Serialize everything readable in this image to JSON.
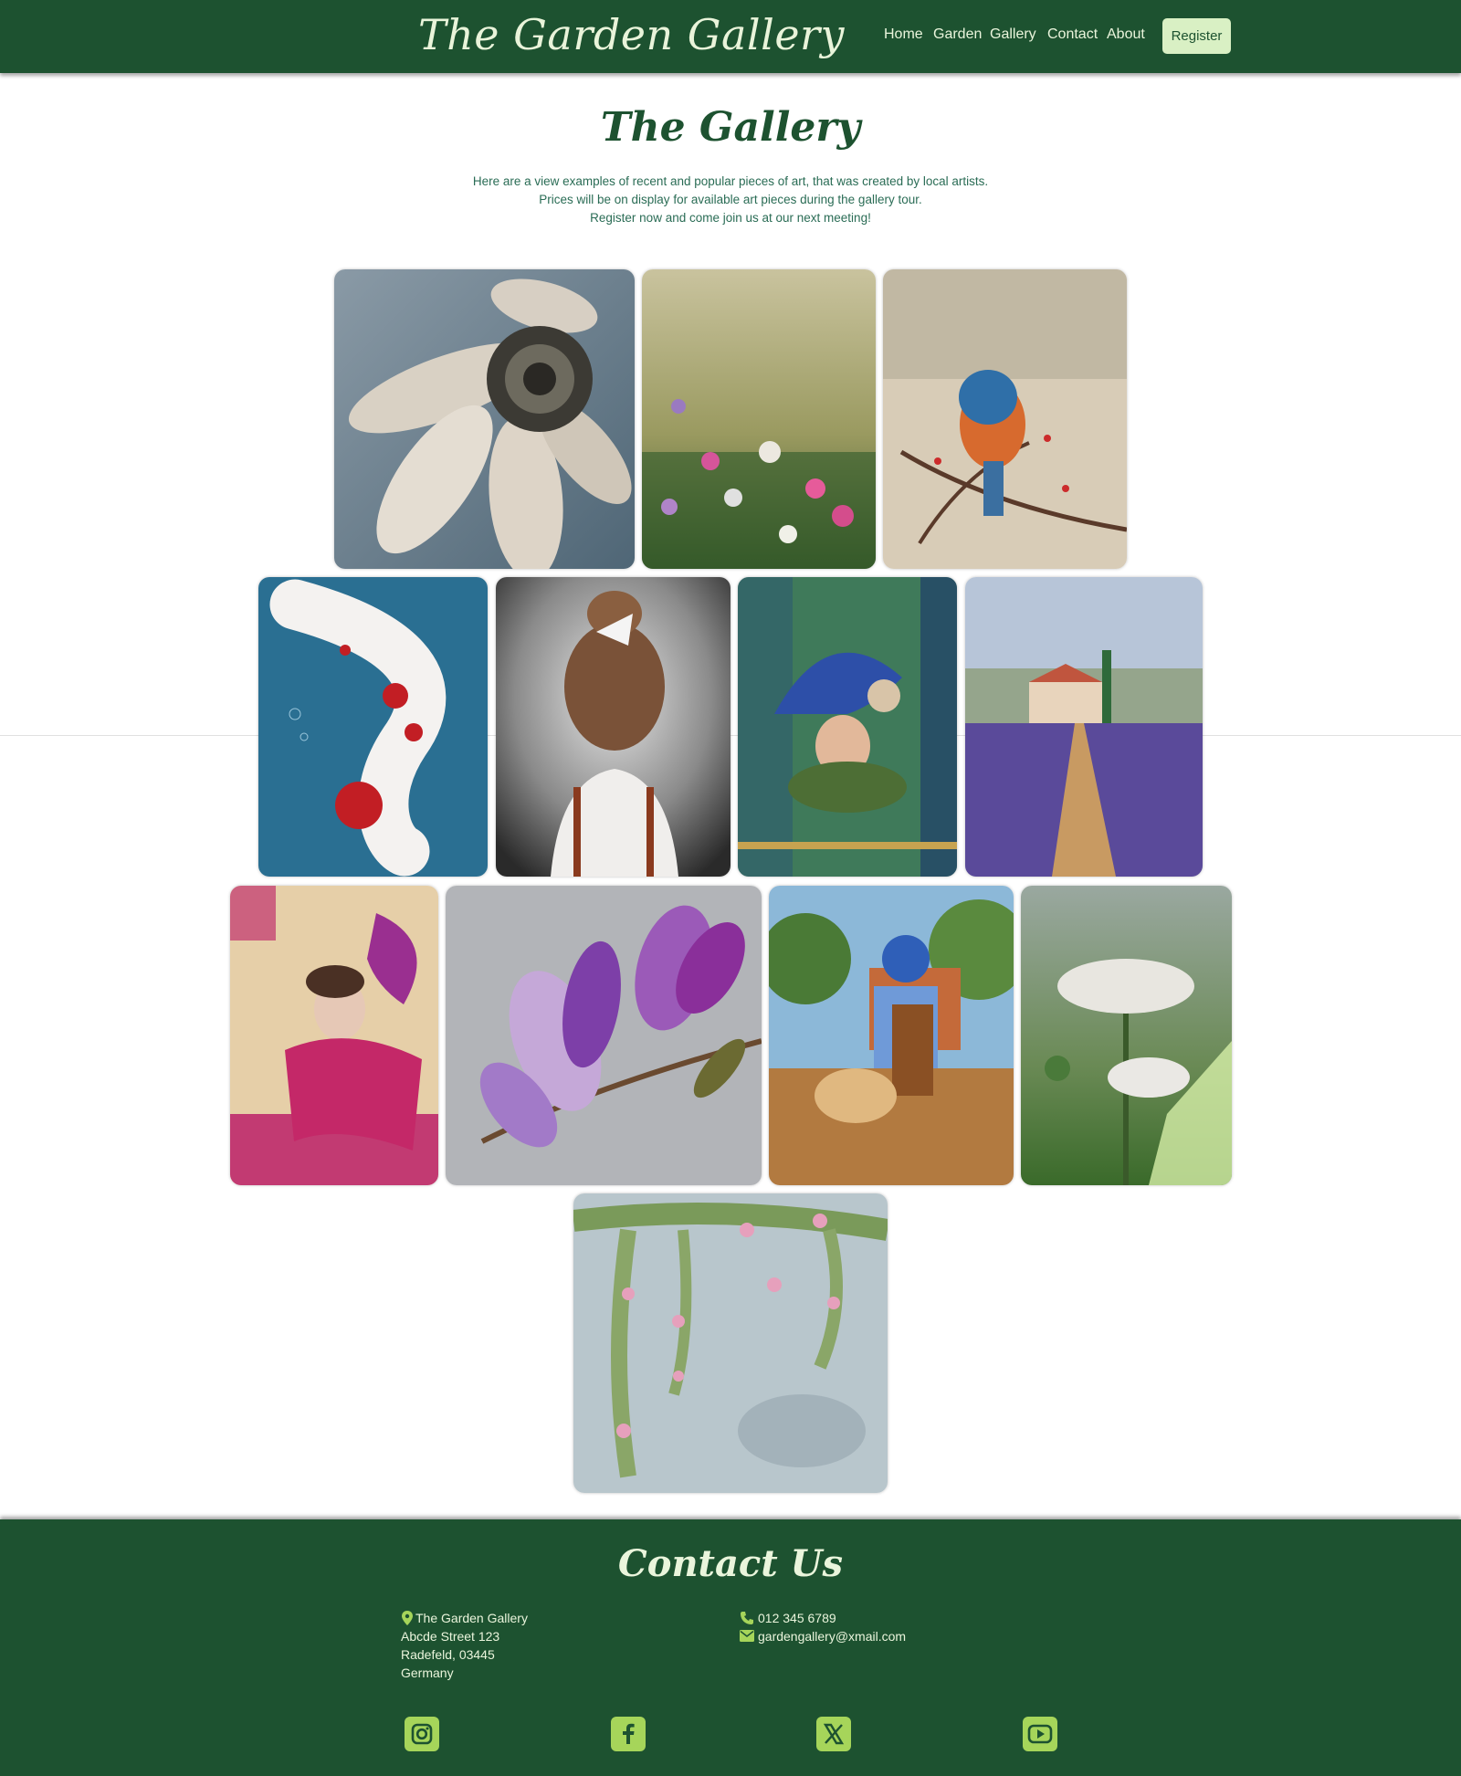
{
  "header": {
    "logo": "The Garden Gallery",
    "nav": [
      "Home",
      "Garden",
      "Gallery",
      "Contact",
      "About"
    ],
    "register": "Register"
  },
  "intro": {
    "title": "The Gallery",
    "lines": [
      "Here are a view examples of recent and popular pieces of art, that was created by local artists.",
      "Prices will be on display for available art pieces during the gallery tour.",
      "Register now and come join us at our next meeting!"
    ]
  },
  "gallery": {
    "items": [
      "white-daisy-painting",
      "wildflower-meadow-painting",
      "bluebird-on-branch-painting",
      "koi-fish-painting",
      "girl-with-bow-painting",
      "woman-with-blue-feathers-painting",
      "lavender-field-cottage-painting",
      "woman-with-pink-wings-painting",
      "purple-magnolia-painting",
      "boy-and-dog-painting",
      "white-wildflowers-painting",
      "pink-blossom-vines-painting"
    ]
  },
  "footer": {
    "title": "Contact Us",
    "address": [
      "The Garden Gallery",
      "Abcde Street 123",
      "Radefeld, 03445",
      "Germany"
    ],
    "phone": "012 345 6789",
    "email": "gardengallery@xmail.com",
    "social": [
      "instagram-icon",
      "facebook-icon",
      "x-icon",
      "youtube-icon"
    ]
  },
  "colors": {
    "primary": "#1d5230",
    "light_text": "#eaf5dc",
    "button_bg": "#d9f0c4",
    "social_bg": "#a6d55a",
    "intro_text": "#2a6c55"
  }
}
